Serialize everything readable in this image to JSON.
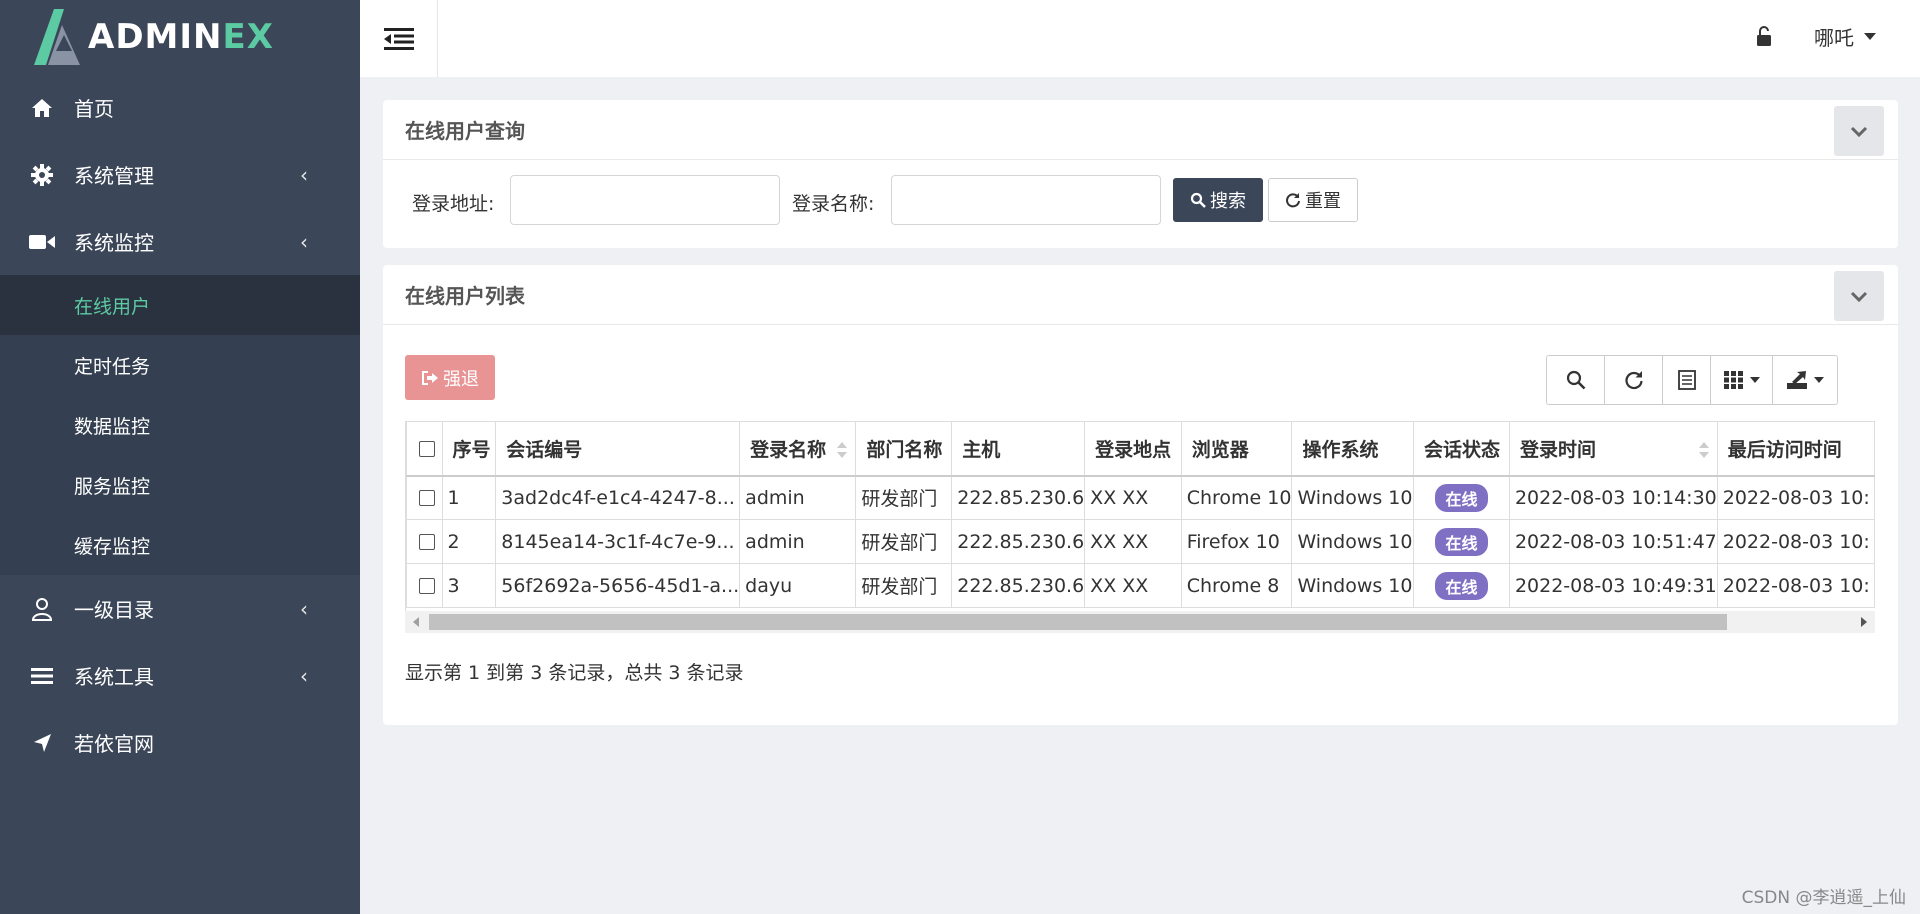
{
  "logo": {
    "main": "ADMIN",
    "accent": "EX"
  },
  "colors": {
    "sidebar": "#3c4659",
    "accent": "#5ccaa3",
    "badge": "#8070c4",
    "danger": "#e89494"
  },
  "sidebar": {
    "items": [
      {
        "label": "首页",
        "icon": "home-icon"
      },
      {
        "label": "系统管理",
        "icon": "gear-icon"
      },
      {
        "label": "系统监控",
        "icon": "video-camera-icon"
      },
      {
        "label": "一级目录",
        "icon": "user-icon"
      },
      {
        "label": "系统工具",
        "icon": "bars-icon"
      },
      {
        "label": "若依官网",
        "icon": "location-arrow-icon"
      }
    ],
    "monitor_sub": [
      {
        "label": "在线用户"
      },
      {
        "label": "定时任务"
      },
      {
        "label": "数据监控"
      },
      {
        "label": "服务监控"
      },
      {
        "label": "缓存监控"
      }
    ]
  },
  "topbar": {
    "username": "哪吒"
  },
  "search": {
    "title": "在线用户查询",
    "ip_label": "登录地址:",
    "ip_value": "",
    "name_label": "登录名称:",
    "name_value": "",
    "search_btn": "搜索",
    "reset_btn": "重置"
  },
  "list": {
    "title": "在线用户列表",
    "kick_btn": "强退",
    "columns": [
      "序号",
      "会话编号",
      "登录名称",
      "部门名称",
      "主机",
      "登录地点",
      "浏览器",
      "操作系统",
      "会话状态",
      "登录时间",
      "最后访问时间"
    ],
    "rows": [
      {
        "no": "1",
        "session": "3ad2dc4f-e1c4-4247-8...",
        "login": "admin",
        "dept": "研发部门",
        "host": "222.85.230.6",
        "loc": "XX XX",
        "browser": "Chrome 10",
        "os": "Windows 10",
        "status": "在线",
        "login_time": "2022-08-03 10:14:30",
        "last_access": "2022-08-03 10:"
      },
      {
        "no": "2",
        "session": "8145ea14-3c1f-4c7e-9...",
        "login": "admin",
        "dept": "研发部门",
        "host": "222.85.230.6",
        "loc": "XX XX",
        "browser": "Firefox 10",
        "os": "Windows 10",
        "status": "在线",
        "login_time": "2022-08-03 10:51:47",
        "last_access": "2022-08-03 10:"
      },
      {
        "no": "3",
        "session": "56f2692a-5656-45d1-a...",
        "login": "dayu",
        "dept": "研发部门",
        "host": "222.85.230.6",
        "loc": "XX XX",
        "browser": "Chrome 8",
        "os": "Windows 10",
        "status": "在线",
        "login_time": "2022-08-03 10:49:31",
        "last_access": "2022-08-03 10:"
      }
    ],
    "pager_info": "显示第 1 到第 3 条记录，总共 3 条记录"
  },
  "watermark": "CSDN @李逍遥_上仙"
}
